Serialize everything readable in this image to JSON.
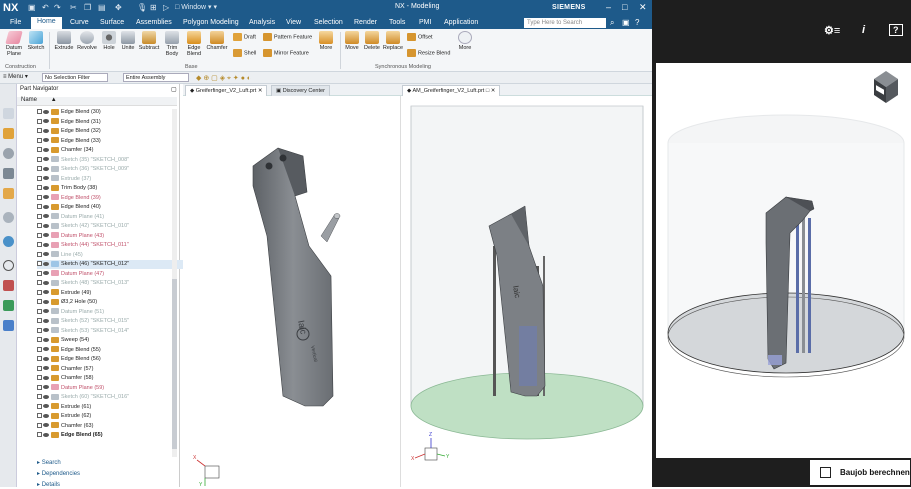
{
  "titlebar": {
    "logo": "NX",
    "window_menu": "Window",
    "title": "NX - Modeling",
    "brand": "SIEMENS"
  },
  "menubar": {
    "items": [
      "File",
      "Home",
      "Curve",
      "Surface",
      "Assemblies",
      "Polygon Modeling",
      "Analysis",
      "View",
      "Selection",
      "Render",
      "Tools",
      "PMI",
      "Application"
    ],
    "active": "Home",
    "search_placeholder": "Type Here to Search"
  },
  "ribbon": {
    "construction": {
      "datum": "Datum Plane",
      "sketch": "Sketch",
      "label": "Construction"
    },
    "base": {
      "extrude": "Extrude",
      "revolve": "Revolve",
      "hole": "Hole",
      "unite": "Unite",
      "subtract": "Subtract",
      "trim": "Trim Body",
      "edge": "Edge Blend",
      "chamfer": "Chamfer",
      "label": "Base"
    },
    "feature": {
      "draft": "Draft",
      "shell": "Shell",
      "pattern": "Pattern Feature",
      "mirror": "Mirror Feature",
      "more": "More"
    },
    "sync": {
      "move": "Move",
      "delete": "Delete",
      "replace": "Replace",
      "offset": "Offset",
      "resize": "Resize Blend",
      "label": "Synchronous Modeling"
    },
    "more": "More",
    "more2": "More"
  },
  "selbar": {
    "menu": "Menu",
    "filter": "No Selection Filter",
    "scope": "Entire Assembly"
  },
  "navigator": {
    "title": "Part Navigator",
    "col_name": "Name",
    "nodes": [
      {
        "label": "Edge Blend (30)",
        "style": "normal"
      },
      {
        "label": "Edge Blend (31)",
        "style": "normal"
      },
      {
        "label": "Edge Blend (32)",
        "style": "normal"
      },
      {
        "label": "Edge Blend (33)",
        "style": "normal"
      },
      {
        "label": "Chamfer (34)",
        "style": "normal"
      },
      {
        "label": "Sketch (35) \"SKETCH_008\"",
        "style": "gray"
      },
      {
        "label": "Sketch (36) \"SKETCH_009\"",
        "style": "gray"
      },
      {
        "label": "Extrude (37)",
        "style": "gray"
      },
      {
        "label": "Trim Body (38)",
        "style": "normal"
      },
      {
        "label": "Edge Blend (39)",
        "style": "pink"
      },
      {
        "label": "Edge Blend (40)",
        "style": "normal"
      },
      {
        "label": "Datum Plane (41)",
        "style": "gray"
      },
      {
        "label": "Sketch (42) \"SKETCH_010\"",
        "style": "gray"
      },
      {
        "label": "Datum Plane (43)",
        "style": "pink"
      },
      {
        "label": "Sketch (44) \"SKETCH_011\"",
        "style": "pink"
      },
      {
        "label": "Line (45)",
        "style": "gray"
      },
      {
        "label": "Sketch (46) \"SKETCH_012\"",
        "style": "hl"
      },
      {
        "label": "Datum Plane (47)",
        "style": "pink"
      },
      {
        "label": "Sketch (48) \"SKETCH_013\"",
        "style": "gray"
      },
      {
        "label": "Extrude (49)",
        "style": "normal"
      },
      {
        "label": "Ø3,2 Hole (50)",
        "style": "normal"
      },
      {
        "label": "Datum Plane (51)",
        "style": "gray"
      },
      {
        "label": "Sketch (52) \"SKETCH_015\"",
        "style": "gray"
      },
      {
        "label": "Sketch (53) \"SKETCH_014\"",
        "style": "gray"
      },
      {
        "label": "Sweep (54)",
        "style": "normal"
      },
      {
        "label": "Edge Blend (55)",
        "style": "normal"
      },
      {
        "label": "Edge Blend (56)",
        "style": "normal"
      },
      {
        "label": "Chamfer (57)",
        "style": "normal"
      },
      {
        "label": "Chamfer (58)",
        "style": "normal"
      },
      {
        "label": "Datum Plane (59)",
        "style": "pink"
      },
      {
        "label": "Sketch (60) \"SKETCH_016\"",
        "style": "gray"
      },
      {
        "label": "Extrude (61)",
        "style": "normal"
      },
      {
        "label": "Extrude (62)",
        "style": "normal"
      },
      {
        "label": "Chamfer (63)",
        "style": "normal"
      },
      {
        "label": "Edge Blend (65)",
        "style": "bold"
      }
    ],
    "panels": [
      "Search",
      "Dependencies",
      "Details"
    ]
  },
  "tabs": [
    {
      "label": "Greiferfinger_V2_Luft.prt"
    },
    {
      "label": "Discovery Center"
    },
    {
      "label": "AM_Greiferfinger_V2_Luft.prt"
    }
  ],
  "app": {
    "button_label": "Baujob berechnen",
    "icons": [
      "settings-icon",
      "info-icon",
      "help-icon"
    ],
    "help_glyph": "?",
    "info_glyph": "i"
  },
  "colors": {
    "nx_blue": "#1e5a8a",
    "app_dark": "#1e1e1e",
    "model_gray": "#707478",
    "platform_green": "#bfe0c4"
  }
}
